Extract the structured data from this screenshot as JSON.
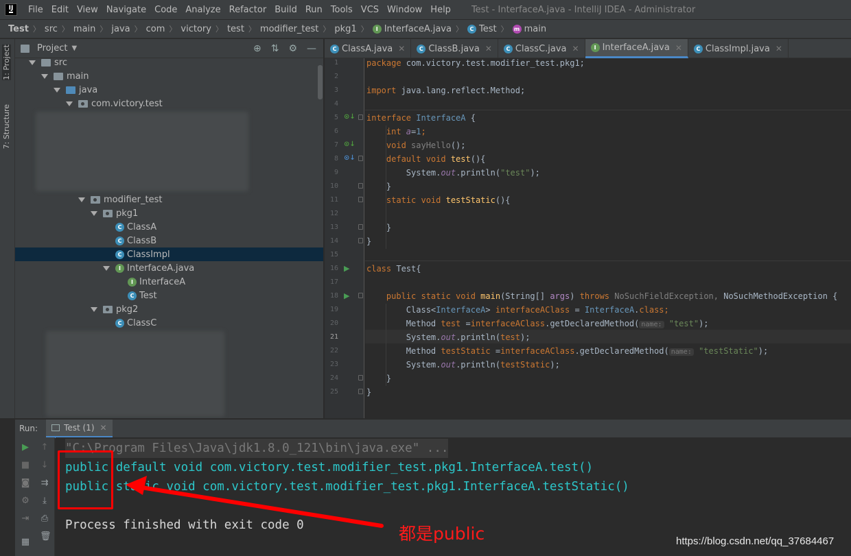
{
  "menubar": {
    "logo": "IJ",
    "items": [
      "File",
      "Edit",
      "View",
      "Navigate",
      "Code",
      "Analyze",
      "Refactor",
      "Build",
      "Run",
      "Tools",
      "VCS",
      "Window",
      "Help"
    ],
    "window_title": "Test - InterfaceA.java - IntelliJ IDEA - Administrator"
  },
  "breadcrumb": [
    "Test",
    "src",
    "main",
    "java",
    "com",
    "victory",
    "test",
    "modifier_test",
    "pkg1",
    "InterfaceA.java",
    "Test",
    "main"
  ],
  "sidebar": {
    "project_tab": "1: Project",
    "structure_tab": "7: Structure"
  },
  "project": {
    "title": "Project",
    "tree": [
      {
        "label": "src",
        "icon": "folder"
      },
      {
        "label": "main",
        "icon": "folder"
      },
      {
        "label": "java",
        "icon": "folder-blue"
      },
      {
        "label": "com.victory.test",
        "icon": "package"
      },
      {
        "label": "modifier_test",
        "icon": "package"
      },
      {
        "label": "pkg1",
        "icon": "package"
      },
      {
        "label": "ClassA",
        "icon": "class-icon"
      },
      {
        "label": "ClassB",
        "icon": "class-icon"
      },
      {
        "label": "ClassImpl",
        "icon": "class-icon"
      },
      {
        "label": "InterfaceA.java",
        "icon": "interface-icon"
      },
      {
        "label": "InterfaceA",
        "icon": "interface-icon"
      },
      {
        "label": "Test",
        "icon": "class-icon"
      },
      {
        "label": "pkg2",
        "icon": "package"
      },
      {
        "label": "ClassC",
        "icon": "class-icon"
      }
    ]
  },
  "editor_tabs": [
    {
      "label": "ClassA.java",
      "icon": "class-icon"
    },
    {
      "label": "ClassB.java",
      "icon": "class-icon"
    },
    {
      "label": "ClassC.java",
      "icon": "class-icon"
    },
    {
      "label": "InterfaceA.java",
      "icon": "interface-icon"
    },
    {
      "label": "ClassImpl.java",
      "icon": "class-icon"
    }
  ],
  "code": {
    "line_numbers": [
      "1",
      "2",
      "3",
      "4",
      "5",
      "6",
      "7",
      "8",
      "9",
      "10",
      "11",
      "12",
      "13",
      "14",
      "15",
      "16",
      "17",
      "18",
      "19",
      "20",
      "21",
      "22",
      "23",
      "24",
      "25"
    ],
    "current_line": "21",
    "l1_kw": "package",
    "l1_rest": " com.victory.test.modifier_test.pkg1;",
    "l3_kw": "import",
    "l3_rest": " java.lang.reflect.Method;",
    "l5_kw": "interface",
    "l5_name": " InterfaceA",
    "l5_rest": " {",
    "l6_kw": "    int",
    "l6_fld": " a",
    "l6_eq": "=",
    "l6_num": "1",
    "l6_end": ";",
    "l7_kw": "    void",
    "l7_fn": " sayHello",
    "l7_end": "();",
    "l8_kw": "    default void",
    "l8_fn": " test",
    "l8_end": "(){",
    "l9_a": "        System.",
    "l9_out": "out",
    "l9_b": ".println(",
    "l9_str": "\"test\"",
    "l9_c": ");",
    "l10": "    }",
    "l11_kw": "    static void",
    "l11_fn": " testStatic",
    "l11_end": "(){",
    "l13": "    }",
    "l14": "}",
    "l16_kw": "class",
    "l16_rest": " Test{",
    "l18_kw": "    public static void",
    "l18_fn": " main",
    "l18_a": "(String[] ",
    "l18_par": "args",
    "l18_b": ") ",
    "l18_kw2": "throws",
    "l18_gray": " NoSuchFieldException,",
    "l18_c": " NoSuchMethodException {",
    "l19_a": "        Class<",
    "l19_i": "InterfaceA",
    "l19_b": "> ",
    "l19_var": "interfaceAClass",
    "l19_c": " = ",
    "l19_i2": "InterfaceA",
    "l19_d": ".",
    "l19_kw": "class",
    "l19_e": ";",
    "l20_a": "        Method ",
    "l20_var": "test",
    "l20_b": " =",
    "l20_var2": "interfaceAClass",
    "l20_c": ".getDeclaredMethod(",
    "l20_hint": "name:",
    "l20_str": " \"test\"",
    "l20_d": ");",
    "l21_a": "        System.",
    "l21_out": "out",
    "l21_b": ".println(",
    "l21_var": "test",
    "l21_c": ");",
    "l22_a": "        Method ",
    "l22_var": "testStatic",
    "l22_b": " =",
    "l22_var2": "interfaceAClass",
    "l22_c": ".getDeclaredMethod(",
    "l22_hint": "name:",
    "l22_str": " \"testStatic\"",
    "l22_d": ");",
    "l23_a": "        System.",
    "l23_out": "out",
    "l23_b": ".println(",
    "l23_var": "testStatic",
    "l23_c": ");",
    "l24": "    }",
    "l25": "}"
  },
  "run": {
    "label": "Run:",
    "tab": "Test (1)",
    "console": {
      "cmd": "\"C:\\Program Files\\Java\\jdk1.8.0_121\\bin\\java.exe\" ...",
      "out1": "public default void com.victory.test.modifier_test.pkg1.InterfaceA.test()",
      "out2": "public static void com.victory.test.modifier_test.pkg1.InterfaceA.testStatic()",
      "exit": "Process finished with exit code 0"
    }
  },
  "annotation": {
    "text": "都是public",
    "color": "#ff0000"
  },
  "watermark": "https://blog.csdn.net/qq_37684467",
  "colors": {
    "accent": "#4a88c7",
    "console_output": "#2cc6c9",
    "keyword": "#cc7832"
  }
}
